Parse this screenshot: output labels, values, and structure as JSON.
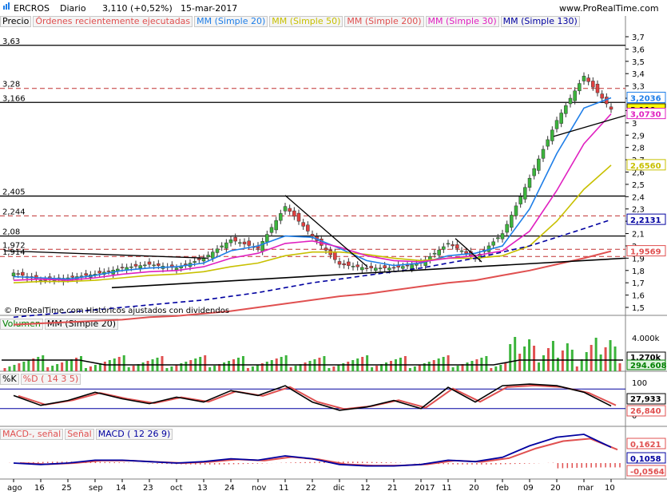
{
  "header": {
    "symbol": "ERCROS",
    "period": "Diario",
    "quote": "3,110 (+0,52%)",
    "date": "15-mar-2017",
    "site": "www.ProRealTime.com"
  },
  "price_panel": {
    "legend": [
      "Precio",
      "Órdenes recientemente ejecutadas",
      "MM (Simple 20)",
      "MM (Simple 50)",
      "MM (Simple 200)",
      "MM (Simple 30)",
      "MM (Simple 130)"
    ],
    "legend_colors": [
      "#000000",
      "#e05050",
      "#1e7ee8",
      "#c8c000",
      "#e05050",
      "#e020c0",
      "#0000a0"
    ],
    "y_ticks": [
      "3,7",
      "3,6",
      "3,5",
      "3,4",
      "3,3",
      "3,2",
      "3,1",
      "3",
      "2,9",
      "2,8",
      "2,7",
      "2,6",
      "2,5",
      "2,4",
      "2,3",
      "2,2",
      "2,1",
      "2",
      "1,9",
      "1,8",
      "1,7",
      "1,6",
      "1,5"
    ],
    "h_levels": [
      {
        "value": 3.63,
        "label": "3,63",
        "style": "solid"
      },
      {
        "value": 3.28,
        "label": "3,28",
        "style": "dashed"
      },
      {
        "value": 3.166,
        "label": "3,166",
        "style": "solid"
      },
      {
        "value": 2.405,
        "label": "2,405",
        "style": "solid"
      },
      {
        "value": 2.244,
        "label": "2,244",
        "style": "dashed"
      },
      {
        "value": 2.08,
        "label": "2,08",
        "style": "solid"
      },
      {
        "value": 1.972,
        "label": "1,972",
        "style": "dashed"
      },
      {
        "value": 1.914,
        "label": "1,914",
        "style": "dashed"
      }
    ],
    "value_tags": [
      {
        "value": 3.2036,
        "label": "3,2036",
        "color": "#1e7ee8"
      },
      {
        "value": 3.11,
        "label": "3,110",
        "color": "#000000",
        "bg": "#ffff00"
      },
      {
        "value": 3.073,
        "label": "3,0730",
        "color": "#e020c0"
      },
      {
        "value": 2.656,
        "label": "2,6560",
        "color": "#c8c000"
      },
      {
        "value": 2.2131,
        "label": "2,2131",
        "color": "#0000a0"
      },
      {
        "value": 1.9569,
        "label": "1,9569",
        "color": "#e05050"
      }
    ],
    "footnote": "© ProRealTime.com Históricos ajustados con dividendos"
  },
  "volume_panel": {
    "legend": [
      "Volumen",
      "MM (Simple 20)"
    ],
    "y_ticks": [
      "4.000k"
    ],
    "value_tags": [
      {
        "label": "1.270k",
        "color": "#000000"
      },
      {
        "label": "294.608",
        "color": "#008000"
      }
    ]
  },
  "stoch_panel": {
    "legend": [
      "%K",
      "%D ( 14 3 5)"
    ],
    "y_ticks": [
      "100",
      "0"
    ],
    "value_tags": [
      {
        "label": "27,933",
        "color": "#000000"
      },
      {
        "label": "26,840",
        "color": "#e05050"
      }
    ]
  },
  "macd_panel": {
    "legend": [
      "MACD-, señal",
      "Señal",
      "MACD ( 12 26 9)"
    ],
    "value_tags": [
      {
        "label": "0,1621",
        "color": "#e05050"
      },
      {
        "label": "0,1058",
        "color": "#0000a0"
      },
      {
        "label": "-0,0564",
        "color": "#e05050"
      }
    ]
  },
  "x_axis": {
    "labels": [
      "ago",
      "16",
      "25",
      "sep",
      "14",
      "23",
      "oct",
      "13",
      "24",
      "nov",
      "11",
      "22",
      "dic",
      "12",
      "21",
      "2017",
      "11",
      "20",
      "feb",
      "09",
      "20",
      "mar",
      "10"
    ]
  },
  "chart_data": {
    "type": "candlestick",
    "title": "ERCROS Diario",
    "ylim": [
      1.45,
      3.75
    ],
    "dates": [
      "ago",
      "16",
      "25",
      "sep",
      "14",
      "23",
      "oct",
      "13",
      "24",
      "nov",
      "11",
      "22",
      "dic",
      "12",
      "21",
      "2017",
      "11",
      "20",
      "feb",
      "09",
      "20",
      "mar",
      "10"
    ],
    "close": [
      1.78,
      1.72,
      1.74,
      1.77,
      1.82,
      1.85,
      1.82,
      1.9,
      2.05,
      1.98,
      2.32,
      2.08,
      1.85,
      1.82,
      1.82,
      1.86,
      2.02,
      1.9,
      2.1,
      2.55,
      3.02,
      3.38,
      3.11
    ],
    "series": [
      {
        "name": "MM (Simple 20)",
        "values": [
          1.75,
          1.74,
          1.73,
          1.76,
          1.8,
          1.82,
          1.83,
          1.86,
          1.96,
          2.0,
          2.08,
          2.07,
          1.98,
          1.88,
          1.84,
          1.86,
          1.92,
          1.94,
          2.0,
          2.3,
          2.75,
          3.12,
          3.2036
        ]
      },
      {
        "name": "MM (Simple 50)",
        "values": [
          1.7,
          1.71,
          1.71,
          1.72,
          1.74,
          1.76,
          1.77,
          1.79,
          1.83,
          1.86,
          1.92,
          1.95,
          1.95,
          1.93,
          1.9,
          1.88,
          1.9,
          1.9,
          1.92,
          2.0,
          2.2,
          2.46,
          2.656
        ]
      },
      {
        "name": "MM (Simple 200)",
        "values": [
          1.36,
          1.37,
          1.38,
          1.39,
          1.4,
          1.42,
          1.43,
          1.45,
          1.47,
          1.5,
          1.53,
          1.56,
          1.59,
          1.61,
          1.64,
          1.67,
          1.7,
          1.72,
          1.76,
          1.8,
          1.85,
          1.9,
          1.9569
        ]
      },
      {
        "name": "MM (Simple 30)",
        "values": [
          1.72,
          1.73,
          1.72,
          1.74,
          1.77,
          1.79,
          1.8,
          1.83,
          1.9,
          1.94,
          2.02,
          2.04,
          1.99,
          1.92,
          1.88,
          1.87,
          1.9,
          1.92,
          1.96,
          2.12,
          2.45,
          2.83,
          3.073
        ]
      },
      {
        "name": "MM (Simple 130)",
        "values": [
          1.42,
          1.44,
          1.46,
          1.48,
          1.5,
          1.52,
          1.54,
          1.56,
          1.59,
          1.62,
          1.66,
          1.7,
          1.73,
          1.76,
          1.79,
          1.82,
          1.86,
          1.9,
          1.95,
          2.0,
          2.07,
          2.14,
          2.2131
        ]
      }
    ]
  }
}
